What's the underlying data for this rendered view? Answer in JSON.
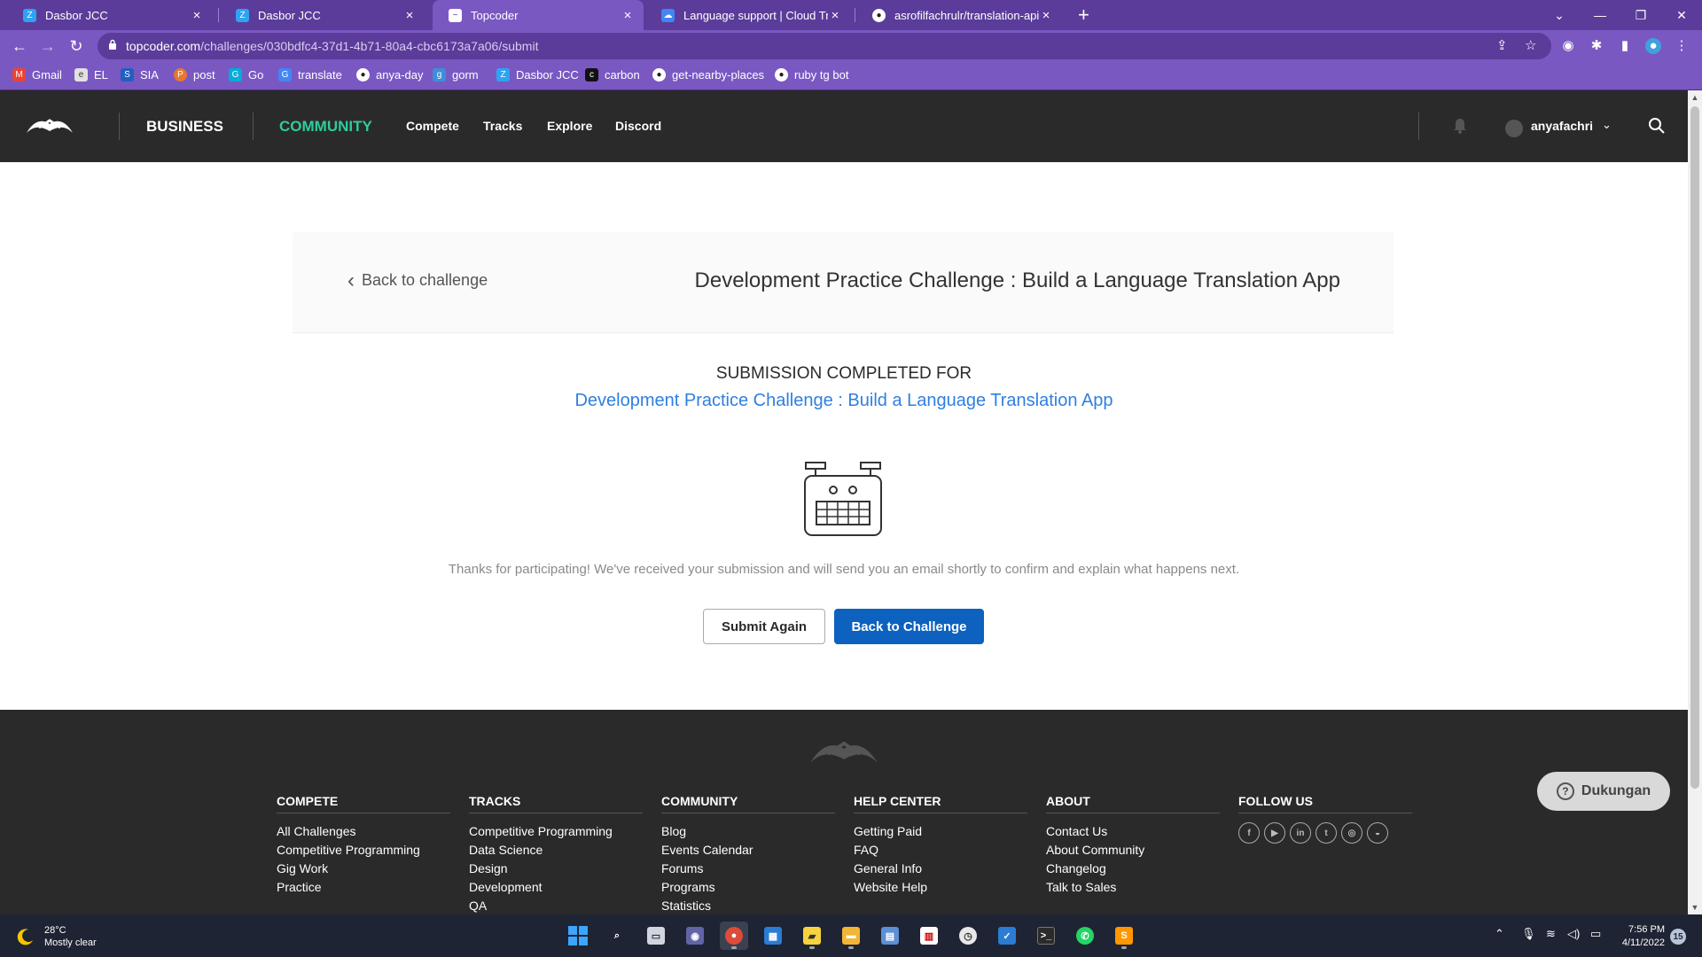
{
  "browser": {
    "tabs": [
      {
        "label": "Dasbor JCC",
        "icon": "dasbor-icon",
        "active": false
      },
      {
        "label": "Dasbor JCC",
        "icon": "dasbor-icon",
        "active": false
      },
      {
        "label": "Topcoder",
        "icon": "topcoder-icon",
        "active": true
      },
      {
        "label": "Language support  |  Cloud Trans",
        "icon": "google-cloud-icon",
        "active": false
      },
      {
        "label": "asrofilfachrulr/translation-api: htt",
        "icon": "github-icon",
        "active": false
      }
    ],
    "url_host": "topcoder.com",
    "url_path": "/challenges/030bdfc4-37d1-4b71-80a4-cbc6173a7a06/submit",
    "bookmarks": [
      {
        "label": "Gmail",
        "icon": "gmail-icon"
      },
      {
        "label": "EL",
        "icon": "el-icon"
      },
      {
        "label": "SIA",
        "icon": "sia-icon"
      },
      {
        "label": "post",
        "icon": "post-icon"
      },
      {
        "label": "Go",
        "icon": "go-icon"
      },
      {
        "label": "translate",
        "icon": "translate-icon"
      },
      {
        "label": "anya-day",
        "icon": "github-icon"
      },
      {
        "label": "gorm",
        "icon": "gorm-icon"
      },
      {
        "label": "Dasbor JCC",
        "icon": "dasbor-icon"
      },
      {
        "label": "carbon",
        "icon": "carbon-icon"
      },
      {
        "label": "get-nearby-places",
        "icon": "github-icon"
      },
      {
        "label": "ruby tg bot",
        "icon": "github-icon"
      }
    ]
  },
  "header": {
    "business": "BUSINESS",
    "community": "COMMUNITY",
    "nav": [
      "Compete",
      "Tracks",
      "Explore",
      "Discord"
    ],
    "username": "anyafachri"
  },
  "challenge_bar": {
    "back_label": "Back to challenge",
    "title": "Development Practice Challenge : Build a Language Translation App"
  },
  "submission": {
    "heading": "SUBMISSION COMPLETED FOR",
    "challenge_link": "Development Practice Challenge : Build a Language Translation App",
    "thanks": "Thanks for participating! We've received your submission and will send you an email shortly to confirm and explain what happens next.",
    "submit_again": "Submit Again",
    "back_to_challenge": "Back to Challenge"
  },
  "footer": {
    "columns": [
      {
        "heading": "COMPETE",
        "items": [
          "All Challenges",
          "Competitive Programming",
          "Gig Work",
          "Practice"
        ]
      },
      {
        "heading": "TRACKS",
        "items": [
          "Competitive Programming",
          "Data Science",
          "Design",
          "Development",
          "QA"
        ]
      },
      {
        "heading": "COMMUNITY",
        "items": [
          "Blog",
          "Events Calendar",
          "Forums",
          "Programs",
          "Statistics"
        ]
      },
      {
        "heading": "HELP CENTER",
        "items": [
          "Getting Paid",
          "FAQ",
          "General Info",
          "Website Help"
        ]
      },
      {
        "heading": "ABOUT",
        "items": [
          "Contact Us",
          "About Community",
          "Changelog",
          "Talk to Sales"
        ]
      }
    ],
    "follow_heading": "FOLLOW US",
    "social": [
      "facebook-icon",
      "youtube-icon",
      "linkedin-icon",
      "twitter-icon",
      "instagram-icon",
      "discord-icon"
    ],
    "support_label": "Dukungan"
  },
  "taskbar": {
    "temperature": "28°C",
    "weather": "Mostly clear",
    "time": "7:56 PM",
    "date": "4/11/2022",
    "notifications": "15"
  },
  "colors": {
    "browser_frame": "#5b3c9a",
    "community_accent": "#2fcc9c",
    "link_blue": "#2f7fe0",
    "primary_button": "#0d61bf"
  }
}
